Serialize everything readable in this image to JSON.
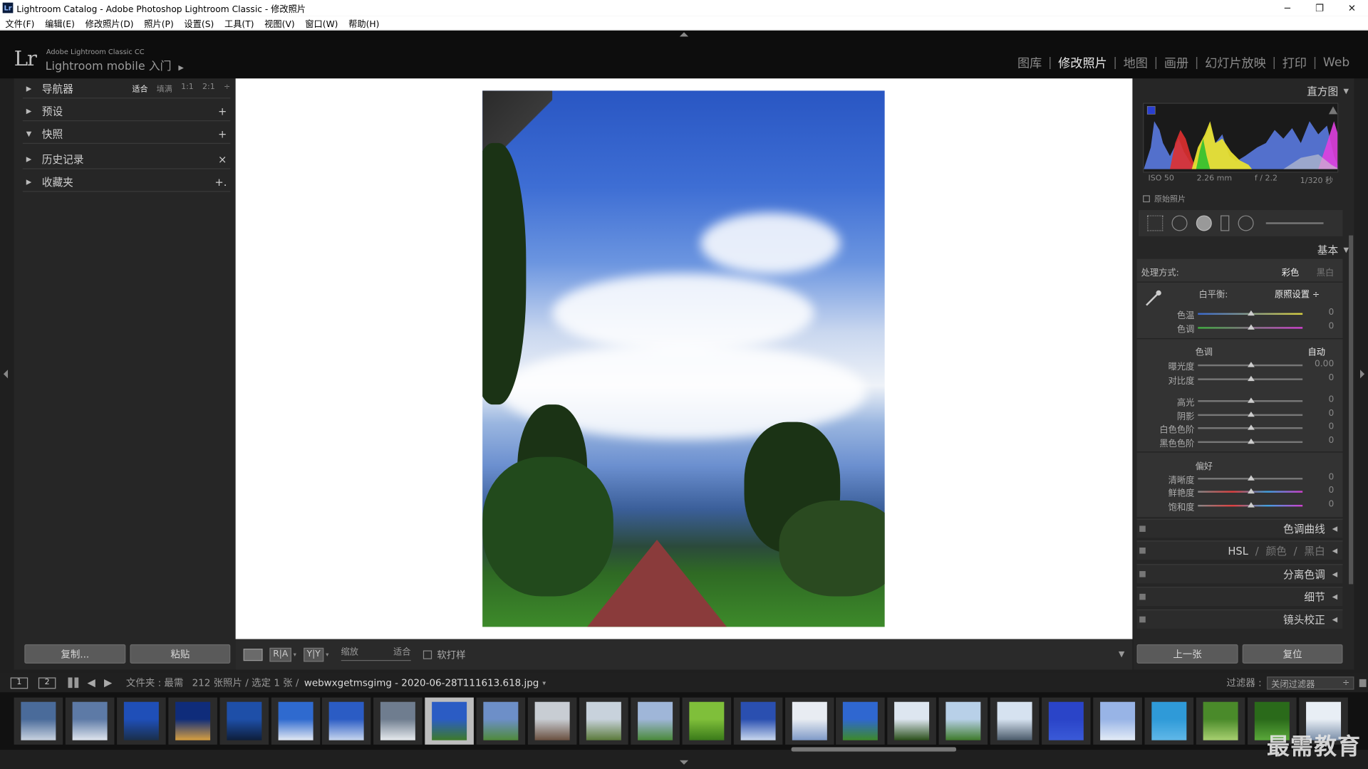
{
  "window": {
    "app_icon": "Lr",
    "title": "Lightroom Catalog - Adobe Photoshop Lightroom Classic - 修改照片",
    "minimize": "─",
    "restore": "❐",
    "close": "✕"
  },
  "menu": [
    "文件(F)",
    "编辑(E)",
    "修改照片(D)",
    "照片(P)",
    "设置(S)",
    "工具(T)",
    "视图(V)",
    "窗口(W)",
    "帮助(H)"
  ],
  "identity": {
    "logo": "Lr",
    "line1": "Adobe Lightroom Classic CC",
    "line2": "Lightroom mobile 入门",
    "arrow": "▶"
  },
  "modules": [
    "图库",
    "修改照片",
    "地图",
    "画册",
    "幻灯片放映",
    "打印",
    "Web"
  ],
  "active_module": "修改照片",
  "module_separator": "|",
  "left_panel": {
    "navigator": {
      "label": "导航器",
      "options": [
        "适合",
        "填满",
        "1:1",
        "2:1"
      ],
      "active_option": "适合",
      "more": "÷"
    },
    "rows": [
      {
        "label": "预设",
        "tri": "▶",
        "action": "+"
      },
      {
        "label": "快照",
        "tri": "▼",
        "action": "+"
      },
      {
        "label": "历史记录",
        "tri": "▶",
        "action": "×"
      },
      {
        "label": "收藏夹",
        "tri": "▶",
        "action": "+."
      }
    ],
    "navigator_tri": "▶",
    "copy_button": "复制...",
    "paste_button": "粘贴"
  },
  "toolbar": {
    "compare_ra": "R|A",
    "compare_yy": "Y|Y",
    "dropdown": "▾",
    "zoom_label": "缩放",
    "zoom_value": "适合",
    "softproof_label": "软打样",
    "menu_arrow": "▼"
  },
  "right_panel": {
    "histogram_title": "直方图",
    "histogram_info": [
      "ISO 50",
      "2.26 mm",
      "f / 2.2",
      "1/320 秒"
    ],
    "original_photo": "原始照片",
    "basic_title": "基本",
    "treatment_label": "处理方式:",
    "treatment_color": "彩色",
    "treatment_bw": "黑白",
    "wb_label": "白平衡:",
    "wb_value": "原照设置 ÷",
    "temp_sliders": [
      {
        "label": "色温",
        "value": "0"
      },
      {
        "label": "色调",
        "value": "0"
      }
    ],
    "tone_label": "色调",
    "auto_label": "自动",
    "tone_sliders": [
      {
        "label": "曝光度",
        "value": "0.00"
      },
      {
        "label": "对比度",
        "value": "0"
      }
    ],
    "light_sliders": [
      {
        "label": "高光",
        "value": "0"
      },
      {
        "label": "阴影",
        "value": "0"
      },
      {
        "label": "白色色阶",
        "value": "0"
      },
      {
        "label": "黑色色阶",
        "value": "0"
      }
    ],
    "presence_label": "偏好",
    "presence_sliders": [
      {
        "label": "清晰度",
        "value": "0"
      },
      {
        "label": "鲜艳度",
        "value": "0"
      },
      {
        "label": "饱和度",
        "value": "0"
      }
    ],
    "panels": [
      "色调曲线",
      "HSL",
      "分离色调",
      "细节",
      "镜头校正"
    ],
    "hsl_extra": [
      "颜色",
      "黑白"
    ],
    "hsl_slash": "/",
    "panel_tri": "◀",
    "title_tri": "▼",
    "prev_button": "上一张",
    "reset_button": "复位"
  },
  "filmstrip_bar": {
    "monitor1": "1",
    "monitor2": "2",
    "back": "◀",
    "forward": "▶",
    "folder_label": "文件夹 : 最需",
    "count": "212 张照片 / 选定 1 张 /",
    "filename": "webwxgetmsgimg - 2020-06-28T111613.618.jpg",
    "file_dd": "▾",
    "filter_label": "过滤器 :",
    "filter_value": "关闭过滤器",
    "filter_dd": "÷"
  },
  "thumbnails": [
    {
      "sel": false,
      "c1": "#4a6b9a",
      "c2": "#c9d3e0"
    },
    {
      "sel": false,
      "c1": "#5d7aa6",
      "c2": "#dfe5ee"
    },
    {
      "sel": false,
      "c1": "#1f4fb8",
      "c2": "#1a2f4a"
    },
    {
      "sel": false,
      "c1": "#0f2c7a",
      "c2": "#d8a040"
    },
    {
      "sel": false,
      "c1": "#1e4fa8",
      "c2": "#0d1e3a"
    },
    {
      "sel": false,
      "c1": "#2f6acf",
      "c2": "#e3e9f3"
    },
    {
      "sel": false,
      "c1": "#2b5cc4",
      "c2": "#c7d6ee"
    },
    {
      "sel": false,
      "c1": "#6f7d8f",
      "c2": "#e6eaee"
    },
    {
      "sel": true,
      "c1": "#2b5cc4",
      "c2": "#3d7a2a"
    },
    {
      "sel": false,
      "c1": "#6d8fc8",
      "c2": "#4f8a3a"
    },
    {
      "sel": false,
      "c1": "#c8cdd3",
      "c2": "#6a5040"
    },
    {
      "sel": false,
      "c1": "#c8d2dc",
      "c2": "#5a7a3a"
    },
    {
      "sel": false,
      "c1": "#9fb6d8",
      "c2": "#4a8a3a"
    },
    {
      "sel": false,
      "c1": "#7fbf3a",
      "c2": "#3a7a1a"
    },
    {
      "sel": false,
      "c1": "#2a4fb0",
      "c2": "#c9d8ee"
    },
    {
      "sel": false,
      "c1": "#e8ecf2",
      "c2": "#7f9ac8"
    },
    {
      "sel": false,
      "c1": "#2f67d0",
      "c2": "#3d8a2a"
    },
    {
      "sel": false,
      "c1": "#dde6f0",
      "c2": "#2a4f1a"
    },
    {
      "sel": false,
      "c1": "#b8d0e8",
      "c2": "#3d7a2a"
    },
    {
      "sel": false,
      "c1": "#d6e2f0",
      "c2": "#4a5a6a"
    },
    {
      "sel": false,
      "c1": "#2a44c8",
      "c2": "#3a5ad8"
    },
    {
      "sel": false,
      "c1": "#98b4e6",
      "c2": "#e3ebf6"
    },
    {
      "sel": false,
      "c1": "#2f9ad8",
      "c2": "#60b8e8"
    },
    {
      "sel": false,
      "c1": "#4a8a2a",
      "c2": "#a8d070"
    },
    {
      "sel": false,
      "c1": "#2a6a1a",
      "c2": "#5aa83a"
    },
    {
      "sel": false,
      "c1": "#e8eef5",
      "c2": "#7a8ea8"
    }
  ],
  "watermark": "最需教育"
}
